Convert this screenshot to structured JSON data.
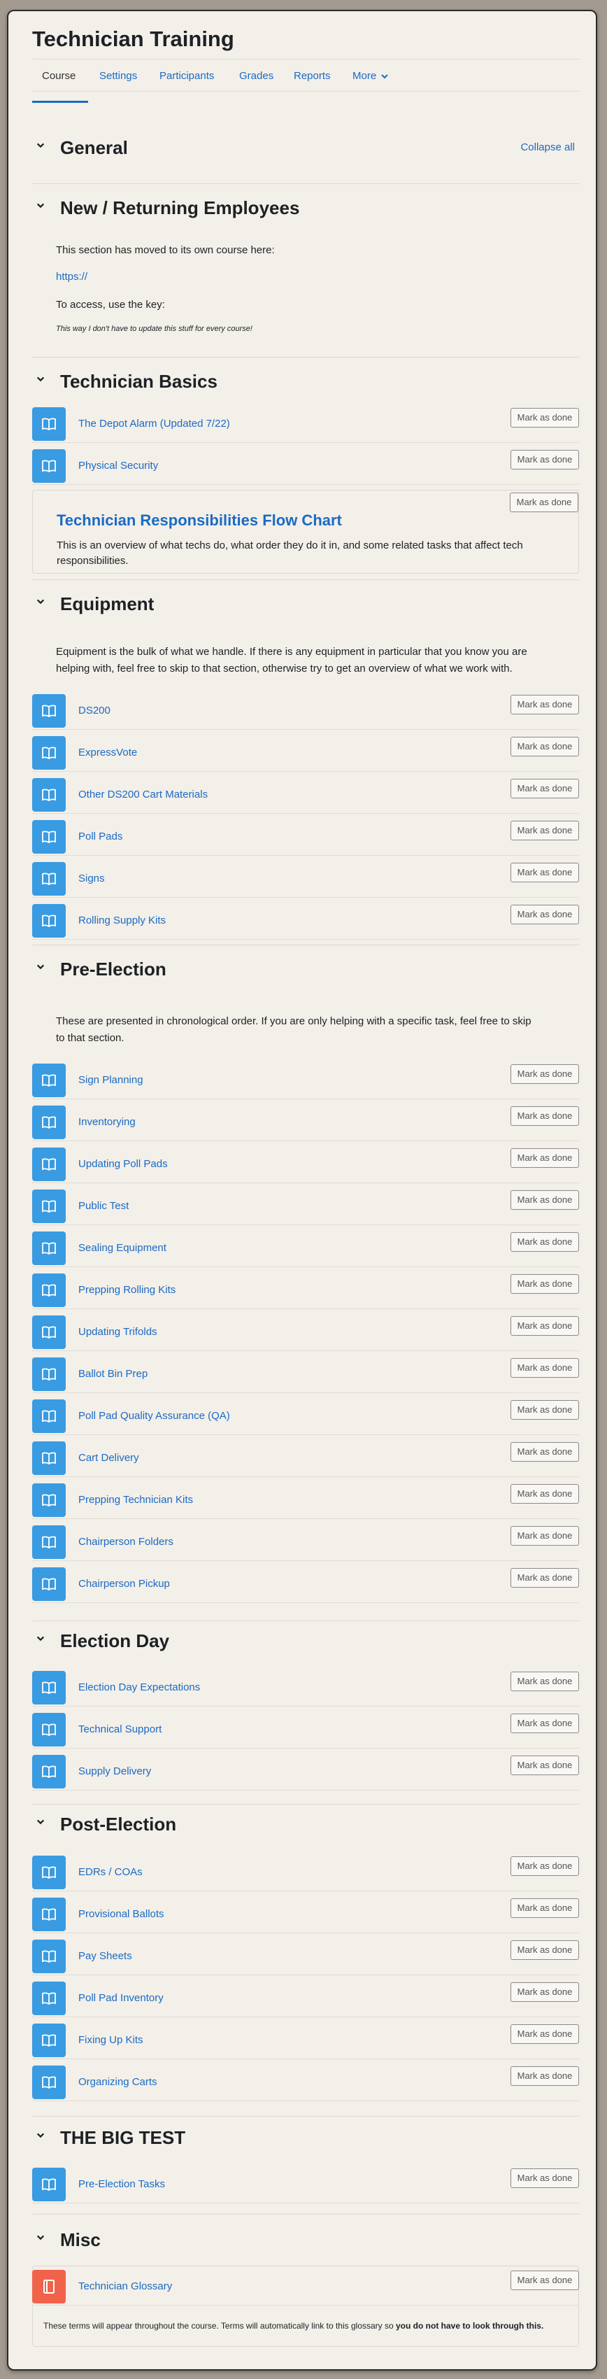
{
  "course": {
    "title": "Technician Training"
  },
  "tabs": [
    "Course",
    "Settings",
    "Participants",
    "Grades",
    "Reports",
    "More"
  ],
  "collapse_all": "Collapse all",
  "mark_label": "Mark as done",
  "sections": {
    "general": {
      "title": "General"
    },
    "new_returning": {
      "title": "New / Returning Employees",
      "lines": [
        "This section has moved to its own course here:",
        "https://",
        "To access, use the key:",
        "This way I don't have to update this stuff for every course!"
      ]
    },
    "basics": {
      "title": "Technician Basics",
      "items": [
        "The Depot Alarm (Updated 7/22)",
        "Physical Security"
      ],
      "label_title": "Technician Responsibilities Flow Chart",
      "label_desc": "This is an overview of what techs do, what order they do it in, and some related tasks that affect tech responsibilities."
    },
    "equipment": {
      "title": "Equipment",
      "summary": "Equipment is the bulk of what we handle. If there is any equipment in particular that you know you are helping with, feel free to skip to that section, otherwise try to get an overview of what we work with.",
      "items": [
        "DS200",
        "ExpressVote",
        "Other DS200 Cart Materials",
        "Poll Pads",
        "Signs",
        "Rolling Supply Kits"
      ]
    },
    "pre_election": {
      "title": "Pre-Election",
      "summary": "These are presented in chronological order. If you are only helping with a specific task, feel free to skip to that section.",
      "items": [
        "Sign Planning",
        "Inventorying",
        "Updating Poll Pads",
        "Public Test",
        "Sealing Equipment",
        "Prepping Rolling Kits",
        "Updating Trifolds",
        "Ballot Bin Prep",
        "Poll Pad Quality Assurance (QA)",
        "Cart Delivery",
        "Prepping Technician Kits",
        "Chairperson Folders",
        "Chairperson Pickup"
      ]
    },
    "election_day": {
      "title": "Election Day",
      "items": [
        "Election Day Expectations",
        "Technical Support",
        "Supply Delivery"
      ]
    },
    "post_election": {
      "title": "Post-Election",
      "items": [
        "EDRs / COAs",
        "Provisional Ballots",
        "Pay Sheets",
        "Poll Pad Inventory",
        "Fixing Up Kits",
        "Organizing Carts"
      ]
    },
    "big_test": {
      "title": "THE BIG TEST",
      "items": [
        "Pre-Election Tasks"
      ]
    },
    "misc": {
      "title": "Misc",
      "items": [
        "Technician Glossary"
      ],
      "note_plain": "These terms will appear throughout the course. Terms will automatically link to this glossary so ",
      "note_bold": "you do not have to look through this."
    }
  },
  "colors": {
    "accent": "#1a6bc4",
    "activity_icon": "#399be2",
    "glossary_icon": "#f1624b"
  },
  "icons": {
    "section_toggle": "chevron-down-icon",
    "page": "book-icon",
    "glossary": "glossary-icon",
    "more": "chevron-down-icon"
  }
}
